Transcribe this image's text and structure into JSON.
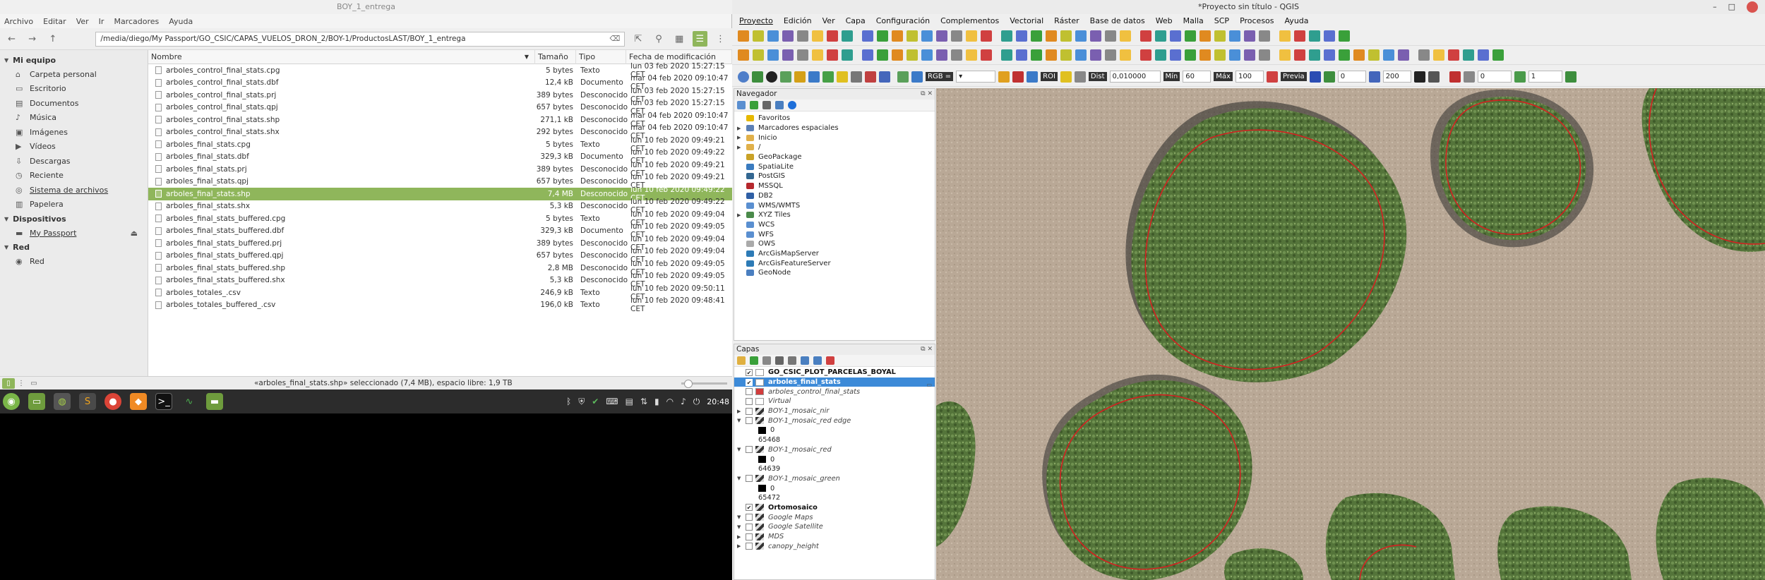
{
  "file_manager": {
    "window_title": "BOY_1_entrega",
    "menu": [
      "Archivo",
      "Editar",
      "Ver",
      "Ir",
      "Marcadores",
      "Ayuda"
    ],
    "path": "/media/diego/My Passport/GO_CSIC/CAPAS_VUELOS_DRON_2/BOY-1/ProductosLAST/BOY_1_entrega",
    "sidebar": {
      "sections": [
        {
          "title": "Mi equipo",
          "items": [
            {
              "label": "Carpeta personal",
              "icon": "home-icon"
            },
            {
              "label": "Escritorio",
              "icon": "desktop-icon"
            },
            {
              "label": "Documentos",
              "icon": "documents-icon"
            },
            {
              "label": "Música",
              "icon": "music-icon"
            },
            {
              "label": "Imágenes",
              "icon": "pictures-icon"
            },
            {
              "label": "Vídeos",
              "icon": "videos-icon"
            },
            {
              "label": "Descargas",
              "icon": "downloads-icon"
            },
            {
              "label": "Reciente",
              "icon": "recent-icon"
            },
            {
              "label": "Sistema de archivos",
              "icon": "filesystem-icon"
            },
            {
              "label": "Papelera",
              "icon": "trash-icon"
            }
          ]
        },
        {
          "title": "Dispositivos",
          "items": [
            {
              "label": "My Passport",
              "icon": "drive-icon"
            }
          ]
        },
        {
          "title": "Red",
          "items": [
            {
              "label": "Red",
              "icon": "network-icon"
            }
          ]
        }
      ]
    },
    "columns": {
      "name": "Nombre",
      "size": "Tamaño",
      "type": "Tipo",
      "modified": "Fecha de modificación"
    },
    "files": [
      {
        "name": "arboles_control_final_stats.cpg",
        "size": "5 bytes",
        "type": "Texto",
        "modified": "lun 03 feb 2020 15:27:15 CET"
      },
      {
        "name": "arboles_control_final_stats.dbf",
        "size": "12,4 kB",
        "type": "Documento",
        "modified": "mar 04 feb 2020 09:10:47 CET"
      },
      {
        "name": "arboles_control_final_stats.prj",
        "size": "389 bytes",
        "type": "Desconocido",
        "modified": "lun 03 feb 2020 15:27:15 CET"
      },
      {
        "name": "arboles_control_final_stats.qpj",
        "size": "657 bytes",
        "type": "Desconocido",
        "modified": "lun 03 feb 2020 15:27:15 CET"
      },
      {
        "name": "arboles_control_final_stats.shp",
        "size": "271,1 kB",
        "type": "Desconocido",
        "modified": "mar 04 feb 2020 09:10:47 CET"
      },
      {
        "name": "arboles_control_final_stats.shx",
        "size": "292 bytes",
        "type": "Desconocido",
        "modified": "mar 04 feb 2020 09:10:47 CET"
      },
      {
        "name": "arboles_final_stats.cpg",
        "size": "5 bytes",
        "type": "Texto",
        "modified": "lun 10 feb 2020 09:49:21 CET"
      },
      {
        "name": "arboles_final_stats.dbf",
        "size": "329,3 kB",
        "type": "Documento",
        "modified": "lun 10 feb 2020 09:49:22 CET"
      },
      {
        "name": "arboles_final_stats.prj",
        "size": "389 bytes",
        "type": "Desconocido",
        "modified": "lun 10 feb 2020 09:49:21 CET"
      },
      {
        "name": "arboles_final_stats.qpj",
        "size": "657 bytes",
        "type": "Desconocido",
        "modified": "lun 10 feb 2020 09:49:21 CET"
      },
      {
        "name": "arboles_final_stats.shp",
        "size": "7,4 MB",
        "type": "Desconocido",
        "modified": "lun 10 feb 2020 09:49:22 CET",
        "selected": true
      },
      {
        "name": "arboles_final_stats.shx",
        "size": "5,3 kB",
        "type": "Desconocido",
        "modified": "lun 10 feb 2020 09:49:22 CET"
      },
      {
        "name": "arboles_final_stats_buffered.cpg",
        "size": "5 bytes",
        "type": "Texto",
        "modified": "lun 10 feb 2020 09:49:04 CET"
      },
      {
        "name": "arboles_final_stats_buffered.dbf",
        "size": "329,3 kB",
        "type": "Documento",
        "modified": "lun 10 feb 2020 09:49:05 CET"
      },
      {
        "name": "arboles_final_stats_buffered.prj",
        "size": "389 bytes",
        "type": "Desconocido",
        "modified": "lun 10 feb 2020 09:49:04 CET"
      },
      {
        "name": "arboles_final_stats_buffered.qpj",
        "size": "657 bytes",
        "type": "Desconocido",
        "modified": "lun 10 feb 2020 09:49:04 CET"
      },
      {
        "name": "arboles_final_stats_buffered.shp",
        "size": "2,8 MB",
        "type": "Desconocido",
        "modified": "lun 10 feb 2020 09:49:05 CET"
      },
      {
        "name": "arboles_final_stats_buffered.shx",
        "size": "5,3 kB",
        "type": "Desconocido",
        "modified": "lun 10 feb 2020 09:49:05 CET"
      },
      {
        "name": "arboles_totales_.csv",
        "size": "246,9 kB",
        "type": "Texto",
        "modified": "lun 10 feb 2020 09:50:11 CET"
      },
      {
        "name": "arboles_totales_buffered_.csv",
        "size": "196,0 kB",
        "type": "Texto",
        "modified": "lun 10 feb 2020 09:48:41 CET"
      }
    ],
    "status": "«arboles_final_stats.shp» seleccionado (7,4 MB), espacio libre: 1,9 TB"
  },
  "taskbar": {
    "apps": [
      "menu-icon",
      "files-icon",
      "qgis-icon",
      "sublime-icon",
      "chrome-icon",
      "firefox-icon",
      "terminal-icon",
      "monitor-icon",
      "folder-icon"
    ],
    "clock": "20:48"
  },
  "qgis": {
    "title": "*Proyecto sin título - QGIS",
    "menu": [
      "Proyecto",
      "Edición",
      "Ver",
      "Capa",
      "Configuración",
      "Complementos",
      "Vectorial",
      "Ráster",
      "Base de datos",
      "Web",
      "Malla",
      "SCP",
      "Procesos",
      "Ayuda"
    ],
    "toolbar3": {
      "rgb_label": "RGB =",
      "dist_label": "Dist",
      "dist_value": "0,010000",
      "min_label": "Mín",
      "min_value": "60",
      "max_label": "Máx",
      "max_value": "100",
      "roi_label": "ROI",
      "preview_label": "Previa",
      "t1_value": "0",
      "t2_value": "200",
      "t3_value": "0",
      "t4_value": "1"
    },
    "navigator": {
      "title": "Navegador",
      "items": [
        {
          "label": "Favoritos",
          "expand": "",
          "icon": "star-icon",
          "color": "#e6b800"
        },
        {
          "label": "Marcadores espaciales",
          "expand": "▶",
          "icon": "bookmark-icon",
          "color": "#5b7fb5"
        },
        {
          "label": "Inicio",
          "expand": "▶",
          "icon": "home-folder-icon",
          "color": "#e0b04a"
        },
        {
          "label": "/",
          "expand": "▶",
          "icon": "root-folder-icon",
          "color": "#e0b04a"
        },
        {
          "label": "GeoPackage",
          "expand": "",
          "icon": "geopackage-icon",
          "color": "#c9a227"
        },
        {
          "label": "SpatiaLite",
          "expand": "",
          "icon": "spatialite-icon",
          "color": "#3a7bbf"
        },
        {
          "label": "PostGIS",
          "expand": "",
          "icon": "postgis-icon",
          "color": "#336791"
        },
        {
          "label": "MSSQL",
          "expand": "",
          "icon": "mssql-icon",
          "color": "#b5282d"
        },
        {
          "label": "DB2",
          "expand": "",
          "icon": "db2-icon",
          "color": "#2f5fa5"
        },
        {
          "label": "WMS/WMTS",
          "expand": "",
          "icon": "wms-icon",
          "color": "#5a8fd0"
        },
        {
          "label": "XYZ Tiles",
          "expand": "▶",
          "icon": "xyz-icon",
          "color": "#4a8a4a"
        },
        {
          "label": "WCS",
          "expand": "",
          "icon": "wcs-icon",
          "color": "#5a8fd0"
        },
        {
          "label": "WFS",
          "expand": "",
          "icon": "wfs-icon",
          "color": "#5a8fd0"
        },
        {
          "label": "OWS",
          "expand": "",
          "icon": "ows-icon",
          "color": "#aaaaaa"
        },
        {
          "label": "ArcGisMapServer",
          "expand": "",
          "icon": "arcgis-map-icon",
          "color": "#2d7bb6"
        },
        {
          "label": "ArcGisFeatureServer",
          "expand": "",
          "icon": "arcgis-feature-icon",
          "color": "#2d7bb6"
        },
        {
          "label": "GeoNode",
          "expand": "",
          "icon": "geonode-icon",
          "color": "#4a7fc0"
        }
      ]
    },
    "layers": {
      "title": "Capas",
      "items": [
        {
          "kind": "layer",
          "label": "GO_CSIC_PLOT_PARCELAS_BOYAL",
          "checked": true,
          "bold": true,
          "expand": "",
          "swatch": "#ffffff"
        },
        {
          "kind": "layer",
          "label": "arboles_final_stats",
          "checked": true,
          "bold": true,
          "selected": true,
          "expand": "",
          "swatch": "#ffffff"
        },
        {
          "kind": "layer",
          "label": "arboles_control_final_stats",
          "checked": false,
          "expand": "",
          "swatch": "#d23c3c"
        },
        {
          "kind": "layer",
          "label": "Virtual",
          "checked": false,
          "expand": "",
          "swatch": "#ffffff"
        },
        {
          "kind": "layer",
          "label": "BOY-1_mosaic_nir",
          "checked": false,
          "expand": "▶",
          "swatch": "raster"
        },
        {
          "kind": "layer",
          "label": "BOY-1_mosaic_red edge",
          "checked": false,
          "expand": "▼",
          "swatch": "raster"
        },
        {
          "kind": "legend",
          "label": "0"
        },
        {
          "kind": "legend-value",
          "label": "65468"
        },
        {
          "kind": "layer",
          "label": "BOY-1_mosaic_red",
          "checked": false,
          "expand": "▼",
          "swatch": "raster"
        },
        {
          "kind": "legend",
          "label": "0"
        },
        {
          "kind": "legend-value",
          "label": "64639"
        },
        {
          "kind": "layer",
          "label": "BOY-1_mosaic_green",
          "checked": false,
          "expand": "▼",
          "swatch": "raster"
        },
        {
          "kind": "legend",
          "label": "0"
        },
        {
          "kind": "legend-value",
          "label": "65472"
        },
        {
          "kind": "layer",
          "label": "Ortomosaico",
          "checked": true,
          "bold": true,
          "expand": "",
          "swatch": "raster"
        },
        {
          "kind": "layer",
          "label": "Google Maps",
          "checked": false,
          "expand": "▼",
          "swatch": "raster"
        },
        {
          "kind": "layer",
          "label": "Google Satellite",
          "checked": false,
          "expand": "▼",
          "swatch": "raster"
        },
        {
          "kind": "layer",
          "label": "MDS",
          "checked": false,
          "expand": "▶",
          "swatch": "raster"
        },
        {
          "kind": "layer",
          "label": "canopy_height",
          "checked": false,
          "expand": "▶",
          "swatch": "raster"
        }
      ]
    }
  },
  "colors": {
    "selection_green": "#8fb65b",
    "qgis_selection": "#3c8ad8",
    "tree_outline": "#d42020",
    "canopy": "#4f6e35",
    "soil": "#b9a896"
  }
}
